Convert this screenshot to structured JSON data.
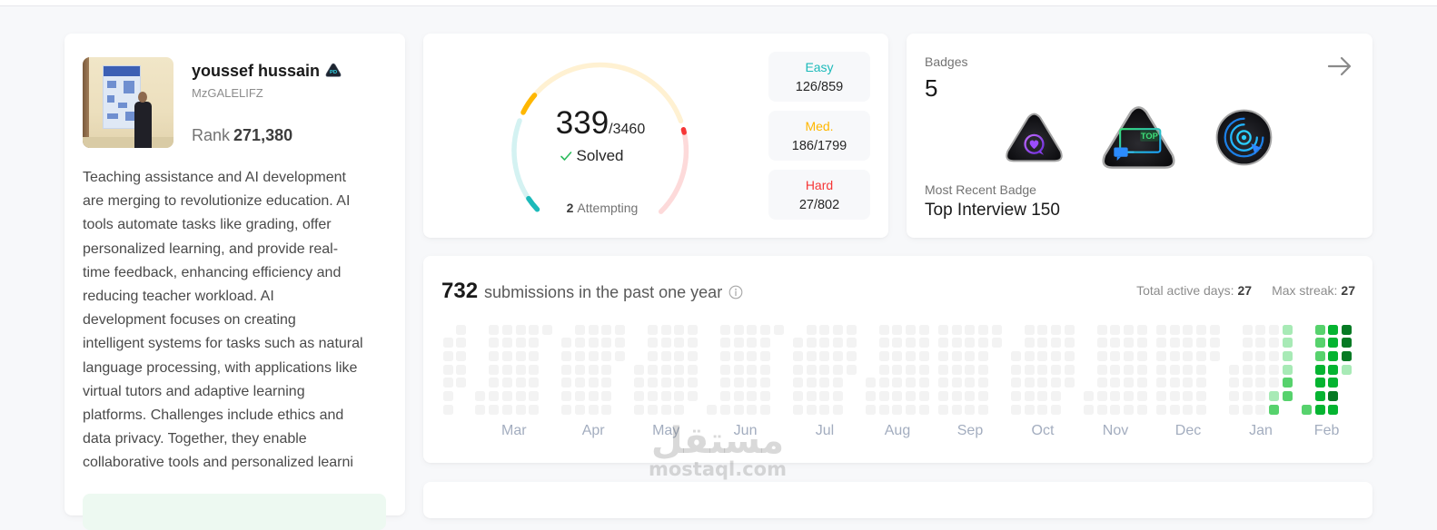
{
  "profile": {
    "name": "youssef hussain",
    "name_badge_text": "PD",
    "username": "MzGALELIFZ",
    "rank_label": "Rank",
    "rank_value": "271,380",
    "bio_lines": [
      "Teaching assistance and AI development",
      "are merging to revolutionize education. AI",
      "tools automate tasks like grading, offer",
      "personalized learning, and provide real-",
      "time feedback, enhancing efficiency and",
      "reducing teacher workload. AI",
      "development focuses on creating",
      "intelligent systems for tasks such as natural",
      "language processing, with applications like",
      "virtual tutors and adaptive learning",
      "platforms. Challenges include ethics and",
      "data privacy. Together, they enable",
      "collaborative tools and personalized learni"
    ]
  },
  "solved": {
    "solved_text": "339",
    "total_text": "/3460",
    "solved_label": "Solved",
    "attempting_count": "2",
    "attempting_label": "Attempting",
    "check_color": "#2cbb5d",
    "difficulties": [
      {
        "label": "Easy",
        "solved": 126,
        "total": 859,
        "text": "126/859",
        "color": "#1cbaba",
        "track": "#d4f2f2"
      },
      {
        "label": "Med.",
        "solved": 186,
        "total": 1799,
        "text": "186/1799",
        "color": "#ffb700",
        "track": "#fff1d2"
      },
      {
        "label": "Hard",
        "solved": 27,
        "total": 802,
        "text": "27/802",
        "color": "#f63737",
        "track": "#fddada"
      }
    ]
  },
  "badges": {
    "title": "Badges",
    "count": "5",
    "arrow_icon": "arrow-right-icon",
    "items": [
      {
        "icon": "heart-chat-badge-icon"
      },
      {
        "icon": "top-interview-badge-icon",
        "glyph_text": "TOP"
      },
      {
        "icon": "target-cursor-badge-icon"
      }
    ],
    "recent_label": "Most Recent Badge",
    "recent_name": "Top Interview 150"
  },
  "submissions": {
    "count": "732",
    "label": "submissions in the past one year",
    "info_icon": "info-icon",
    "active_days_label": "Total active days:",
    "active_days": "27",
    "max_streak_label": "Max streak:",
    "max_streak": "27",
    "heatmap": {
      "level_colors": [
        "#f3f3f3",
        "#a8eab6",
        "#57d26d",
        "#05b431",
        "#067a24"
      ],
      "months": [
        {
          "label": "",
          "first_weekday": 1,
          "days": 11,
          "levels": {}
        },
        {
          "label": "Mar",
          "first_weekday": 5,
          "days": 31,
          "levels": {}
        },
        {
          "label": "Apr",
          "first_weekday": 1,
          "days": 30,
          "levels": {}
        },
        {
          "label": "May",
          "first_weekday": 3,
          "days": 31,
          "levels": {}
        },
        {
          "label": "Jun",
          "first_weekday": 6,
          "days": 30,
          "levels": {}
        },
        {
          "label": "Jul",
          "first_weekday": 1,
          "days": 31,
          "levels": {}
        },
        {
          "label": "Aug",
          "first_weekday": 4,
          "days": 31,
          "levels": {}
        },
        {
          "label": "Sep",
          "first_weekday": 0,
          "days": 30,
          "levels": {}
        },
        {
          "label": "Oct",
          "first_weekday": 2,
          "days": 31,
          "levels": {}
        },
        {
          "label": "Nov",
          "first_weekday": 5,
          "days": 30,
          "levels": {}
        },
        {
          "label": "Dec",
          "first_weekday": 0,
          "days": 31,
          "levels": {}
        },
        {
          "label": "Jan",
          "first_weekday": 3,
          "days": 31,
          "levels": {
            "24": 1,
            "25": 2,
            "26": 1,
            "27": 1,
            "28": 1,
            "29": 1,
            "30": 2,
            "31": 2
          }
        },
        {
          "label": "Feb",
          "first_weekday": 6,
          "days": 19,
          "levels": {
            "1": 2,
            "2": 2,
            "3": 2,
            "4": 2,
            "5": 3,
            "6": 3,
            "7": 3,
            "8": 3,
            "9": 3,
            "10": 3,
            "11": 3,
            "12": 3,
            "13": 3,
            "14": 4,
            "15": 3,
            "16": 4,
            "17": 4,
            "18": 4,
            "19": 1
          }
        }
      ]
    }
  },
  "watermark": {
    "arabic": "مستقل",
    "latin": "mostaql.com"
  }
}
